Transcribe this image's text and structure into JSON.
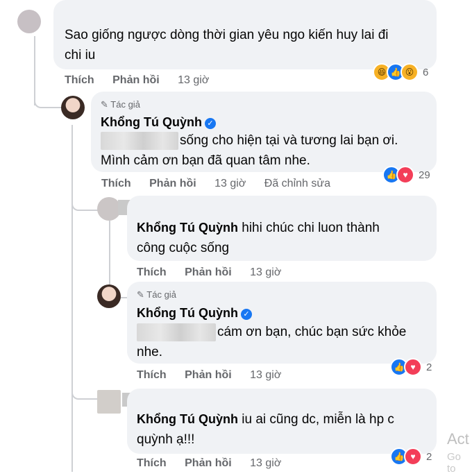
{
  "actions": {
    "like": "Thích",
    "reply": "Phản hồi"
  },
  "author_tag": "Tác giả",
  "author_name": "Khổng Tú Quỳnh",
  "comments": [
    {
      "text_line1": "Sao giống ngược dòng thời gian yêu ngo kiến huy lai đi",
      "text_line2": "chi iu",
      "time": "13 giờ",
      "reaction_count": "6"
    },
    {
      "text_line1": "sống cho hiện tại và tương lai bạn ơi.",
      "text_line2": "Mình cảm ơn bạn đã quan tâm nhe.",
      "time": "13 giờ",
      "edited": "Đã chỉnh sửa",
      "reaction_count": "29"
    },
    {
      "mention": "Khổng Tú Quỳnh",
      "text_line1": "hihi chúc chi luon thành",
      "text_line2": "công cuộc sống",
      "time": "13 giờ"
    },
    {
      "text_line1": "cám ơn bạn, chúc bạn sức khỏe",
      "text_line2": "nhe.",
      "time": "13 giờ",
      "reaction_count": "2"
    },
    {
      "mention": "Khổng Tú Quỳnh",
      "text_line1": "iu ai cũng dc, miễn là hp c",
      "text_line2": "quỳnh ạ!!!",
      "time": "13 giờ",
      "reaction_count": "2"
    }
  ],
  "watermark": {
    "line1": "Act",
    "line2": "Go to"
  },
  "icons": [
    "pencil-icon",
    "verified-icon",
    "like-reaction-icon",
    "love-reaction-icon",
    "haha-reaction-icon",
    "wow-reaction-icon"
  ]
}
